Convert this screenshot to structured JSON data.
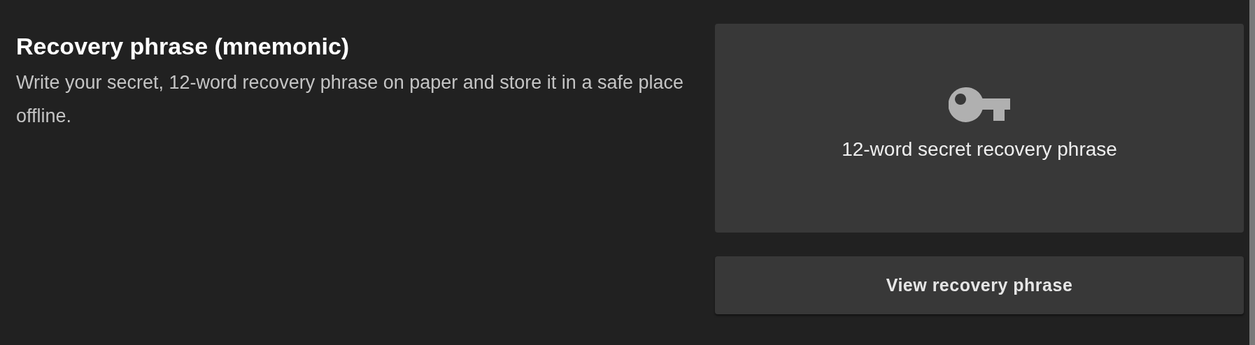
{
  "section": {
    "title": "Recovery phrase (mnemonic)",
    "description": "Write your secret, 12-word recovery phrase on paper and store it in a safe place offline."
  },
  "card": {
    "label": "12-word secret recovery phrase"
  },
  "button": {
    "label": "View recovery phrase"
  }
}
